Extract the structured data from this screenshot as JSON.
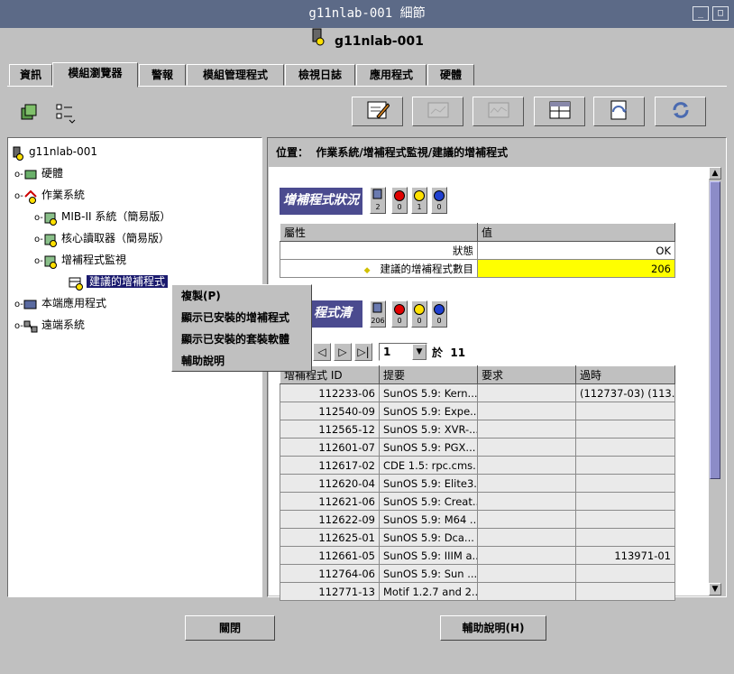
{
  "window": {
    "title": "g11nlab-001 細節",
    "minimize": "_",
    "maximize": "□",
    "host": "g11nlab-001"
  },
  "tabs": [
    {
      "label": "資訊"
    },
    {
      "label": "模組瀏覽器"
    },
    {
      "label": "警報"
    },
    {
      "label": "模組管理程式"
    },
    {
      "label": "檢視日誌"
    },
    {
      "label": "應用程式"
    },
    {
      "label": "硬體"
    }
  ],
  "tree": {
    "root": "g11nlab-001",
    "hardware": "硬體",
    "os": "作業系統",
    "mib": "MIB-II 系統（簡易版）",
    "kernel": "核心讀取器（簡易版）",
    "patch_monitor": "增補程式監視",
    "recommended": "建議的增補程式",
    "local_apps": "本端應用程式",
    "remote": "遠端系統"
  },
  "context_menu": {
    "items": [
      {
        "label": "複製(P)"
      },
      {
        "label": "顯示已安裝的增補程式"
      },
      {
        "label": "顯示已安裝的套裝軟體"
      },
      {
        "label": "輔助說明"
      }
    ]
  },
  "location": {
    "label": "位置：",
    "path": "作業系統/增補程式監視/建議的增補程式"
  },
  "status_section": {
    "title": "增補程式狀況",
    "counts": [
      "2",
      "0",
      "1",
      "0"
    ],
    "col_attr": "屬性",
    "col_value": "值",
    "rows": [
      {
        "attr": "狀態",
        "value": "OK"
      },
      {
        "attr": "建議的增補程式數目",
        "value": "206"
      }
    ]
  },
  "list_section": {
    "title": "程式清單",
    "counts": [
      "206",
      "0",
      "0",
      "0"
    ],
    "page": "1",
    "of": "於",
    "total": "11",
    "columns": [
      "增補程式 ID",
      "提要",
      "要求",
      "過時"
    ],
    "rows": [
      {
        "id": "112233-06",
        "synopsis": "SunOS 5.9: Kern...",
        "req": "",
        "obs": "(112737-03) (113..."
      },
      {
        "id": "112540-09",
        "synopsis": "SunOS 5.9: Expe...",
        "req": "",
        "obs": ""
      },
      {
        "id": "112565-12",
        "synopsis": "SunOS 5.9: XVR-...",
        "req": "",
        "obs": ""
      },
      {
        "id": "112601-07",
        "synopsis": "SunOS 5.9: PGX...",
        "req": "",
        "obs": ""
      },
      {
        "id": "112617-02",
        "synopsis": "CDE 1.5: rpc.cms...",
        "req": "",
        "obs": ""
      },
      {
        "id": "112620-04",
        "synopsis": "SunOS 5.9: Elite3...",
        "req": "",
        "obs": ""
      },
      {
        "id": "112621-06",
        "synopsis": "SunOS 5.9: Creat...",
        "req": "",
        "obs": ""
      },
      {
        "id": "112622-09",
        "synopsis": "SunOS 5.9: M64 ...",
        "req": "",
        "obs": ""
      },
      {
        "id": "112625-01",
        "synopsis": "SunOS 5.9: Dca...",
        "req": "",
        "obs": ""
      },
      {
        "id": "112661-05",
        "synopsis": "SunOS 5.9: IIIM a...",
        "req": "",
        "obs": "113971-01"
      },
      {
        "id": "112764-06",
        "synopsis": "SunOS 5.9: Sun ...",
        "req": "",
        "obs": ""
      },
      {
        "id": "112771-13",
        "synopsis": "Motif 1.2.7 and 2....",
        "req": "",
        "obs": ""
      }
    ]
  },
  "buttons": {
    "close": "關閉",
    "help": "輔助說明(H)"
  }
}
